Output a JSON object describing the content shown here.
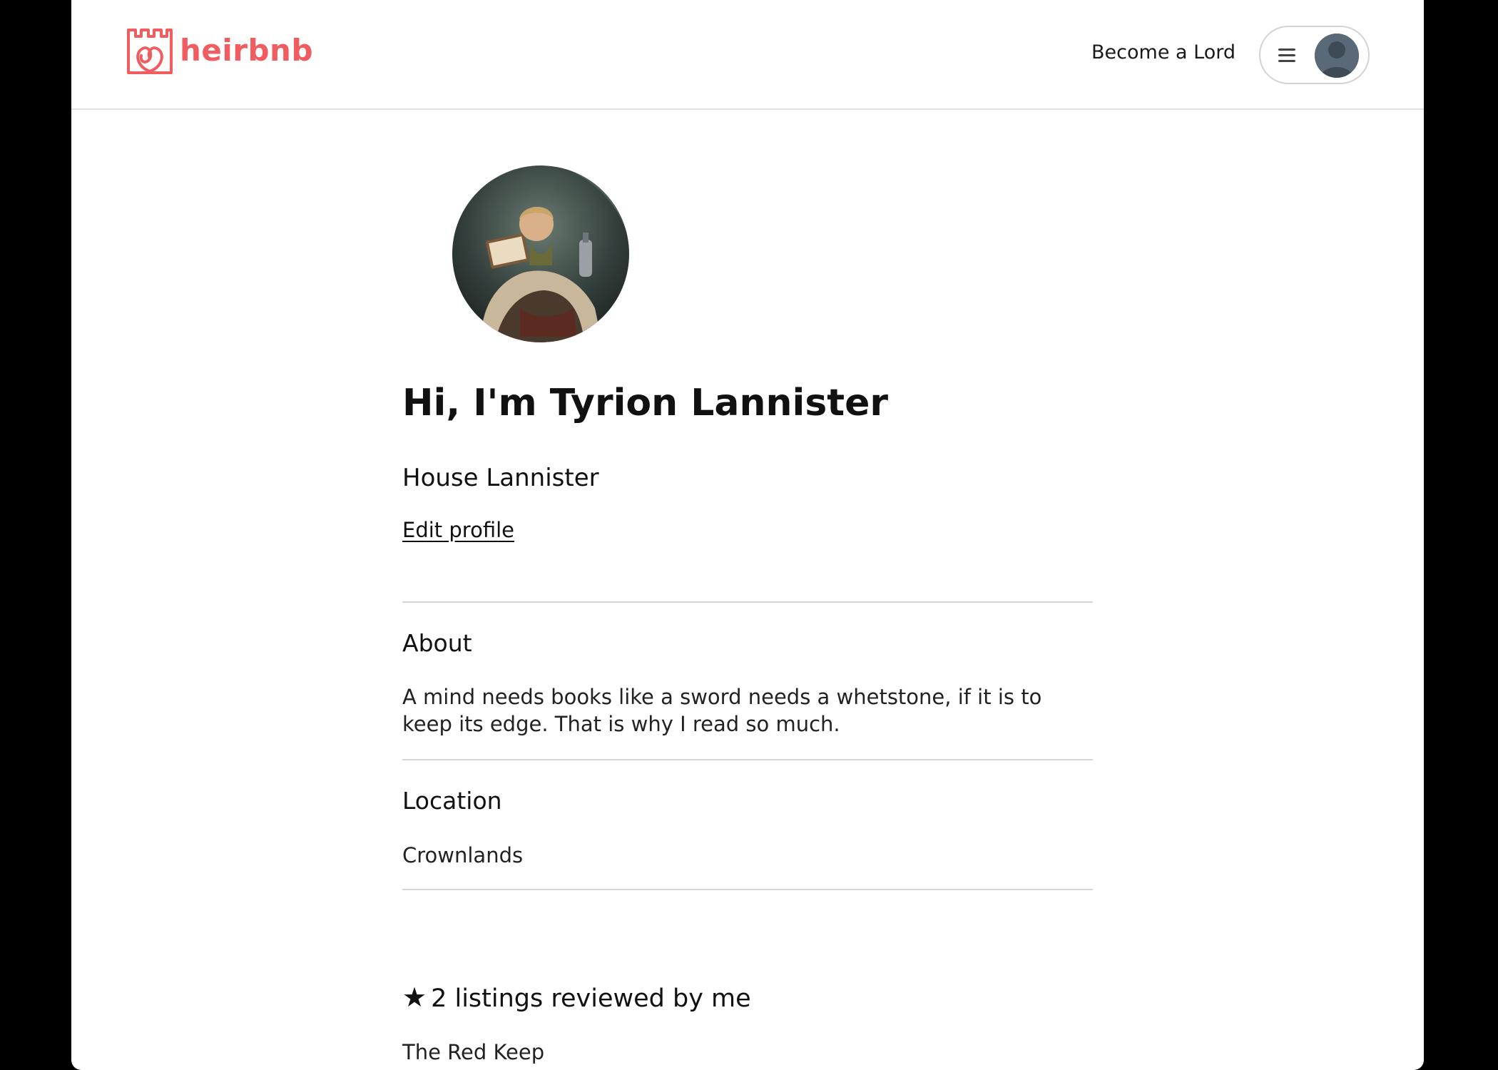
{
  "header": {
    "logo_text": "heirbnb",
    "become_lord_label": "Become a Lord",
    "brand_color": "#f15c60",
    "menu_icon": "hamburger-menu-icon",
    "avatar_icon": "user-avatar-icon"
  },
  "profile": {
    "greeting": "Hi, I'm Tyrion Lannister",
    "house": "House Lannister",
    "edit_label": "Edit profile"
  },
  "about": {
    "title": "About",
    "text": "A mind needs books like a sword needs a whetstone, if it is to keep its edge. That is why I read so much."
  },
  "location": {
    "title": "Location",
    "text": "Crownlands"
  },
  "reviews": {
    "star": "★",
    "title": "2 listings reviewed by me",
    "items": [
      "The Red Keep"
    ]
  }
}
